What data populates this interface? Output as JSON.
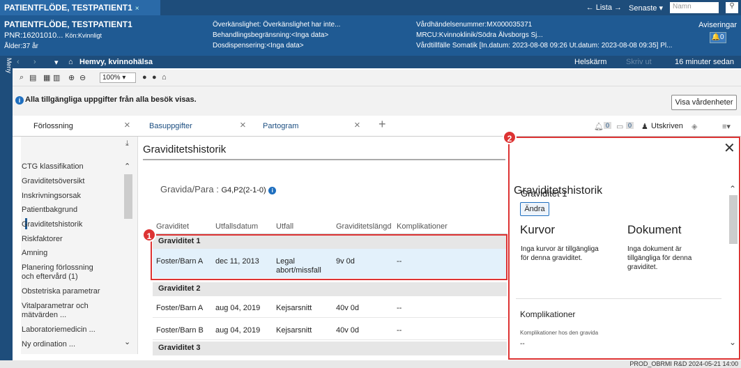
{
  "top_tab": {
    "title": "PATIENTFLÖDE, TESTPATIENT1",
    "close": "×"
  },
  "topright": {
    "lista": "← Lista →",
    "senaste": "Senaste ▾",
    "search_placeholder": "Namn"
  },
  "patient": {
    "name": "PATIENTFLÖDE, TESTPATIENT1",
    "pnr": "PNR:16201010...",
    "kon": "Kön:Kvinnligt",
    "alder": "Ålder:37 år",
    "overkanslighet": "Överkänslighet: Överkänslighet har inte...",
    "behandling": "Behandlingsbegränsning:<Inga data>",
    "dosdisp": "Dosdispensering:<Inga data>",
    "vardhandelse": "Vårdhändelsenummer:MX000035371",
    "mrcu": "MRCU:Kvinnoklinik/Södra Älvsborgs Sj...",
    "vardtillfalle": "Vårdtillfälle Somatik [In.datum: 2023-08-08 09:26 Ut.datum: 2023-08-08 09:35] Pl...",
    "aviseringar": "Aviseringar",
    "avis_count": "0"
  },
  "nav": {
    "home": "Hemvy, kvinnohälsa",
    "helskarm": "Helskärm",
    "skriv": "Skriv ut",
    "timer": "16 minuter sedan"
  },
  "meny": "Meny",
  "toolbar": {
    "zoom": "100%"
  },
  "info": {
    "text": "Alla tillgängliga uppgifter från alla besök visas.",
    "visa": "Visa vårdenheter"
  },
  "tabs": [
    {
      "label": "Förlossning"
    },
    {
      "label": "Basuppgifter"
    },
    {
      "label": "Partogram"
    }
  ],
  "tabright": {
    "c1": "0",
    "c2": "0",
    "utskriven": "Utskriven"
  },
  "sidebar": [
    "CTG klassifikation",
    "Graviditetsöversikt",
    "Inskrivningsorsak",
    "Patientbakgrund",
    "Graviditetshistorik",
    "Riskfaktorer",
    "Amning",
    "Planering förlossning",
    "och eftervård (1)",
    "Obstetriska parametrar",
    "Vitalparametrar och",
    "mätvärden ...",
    "Laboratoriemedicin ...",
    "Ny ordination ..."
  ],
  "main": {
    "title": "Graviditetshistorik",
    "gravpara_label": "Gravida/Para :",
    "gravpara_value": "G4,P2(2-1-0)",
    "headers": [
      "Graviditet",
      "Utfallsdatum",
      "Utfall",
      "Graviditetslängd",
      "Komplikationer"
    ],
    "groups": [
      {
        "name": "Graviditet 1",
        "rows": [
          {
            "g": "Foster/Barn A",
            "d": "dec 11, 2013",
            "u1": "Legal",
            "u2": "abort/missfall",
            "l": "9v 0d",
            "k": "--"
          }
        ]
      },
      {
        "name": "Graviditet 2",
        "rows": [
          {
            "g": "Foster/Barn A",
            "d": "aug 04, 2019",
            "u1": "Kejsarsnitt",
            "u2": "",
            "l": "40v 0d",
            "k": "--"
          },
          {
            "g": "Foster/Barn B",
            "d": "aug 04, 2019",
            "u1": "Kejsarsnitt",
            "u2": "",
            "l": "40v 0d",
            "k": "--"
          }
        ]
      },
      {
        "name": "Graviditet 3",
        "rows": []
      }
    ]
  },
  "panel": {
    "title": "Graviditetshistorik",
    "subtitle": "Graviditet 1",
    "edit": "Ändra",
    "kurvor": "Kurvor",
    "kurvor_text1": "Inga kurvor är tillgängliga",
    "kurvor_text2": "för denna graviditet.",
    "dokument": "Dokument",
    "dok_text1": "Inga dokument är",
    "dok_text2": "tillgängliga för denna",
    "dok_text3": "graviditet.",
    "komp": "Komplikationer",
    "komp_text": "Komplikationer hos den gravida",
    "komp_val": "--"
  },
  "markers": {
    "one": "1",
    "two": "2"
  },
  "status": "PROD_OBRMI R&D  2024-05-21  14:00"
}
